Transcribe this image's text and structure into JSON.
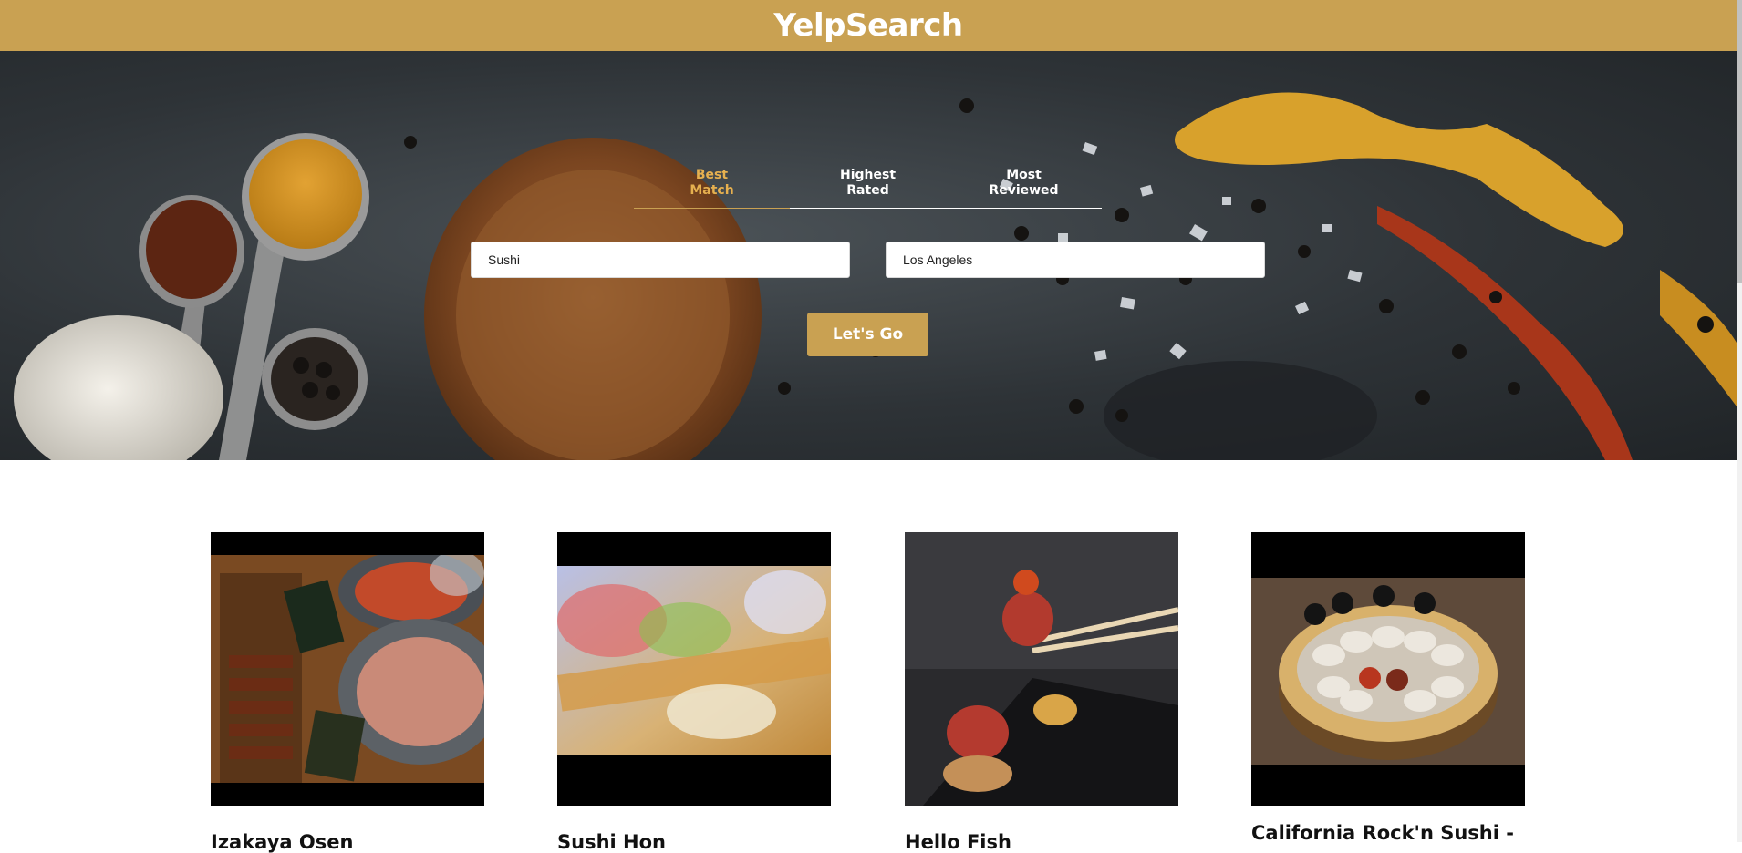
{
  "app": {
    "title": "YelpSearch"
  },
  "search": {
    "sort_options": [
      {
        "label": "Best\nMatch",
        "active": true
      },
      {
        "label": "Highest\nRated",
        "active": false
      },
      {
        "label": "Most\nReviewed",
        "active": false
      }
    ],
    "term_value": "Sushi",
    "location_value": "Los Angeles",
    "submit_label": "Let's Go"
  },
  "results": [
    {
      "name": "Izakaya Osen",
      "photo": "skewers-and-rice-bowls"
    },
    {
      "name": "Sushi Hon",
      "photo": "sashimi-boat"
    },
    {
      "name": "Hello Fish",
      "photo": "tuna-bites-with-chopsticks"
    },
    {
      "name": "California Rock'n Sushi -",
      "photo": "oyster-platter"
    }
  ],
  "colors": {
    "accent": "#c9a152",
    "active_tab": "#e6b04f"
  }
}
